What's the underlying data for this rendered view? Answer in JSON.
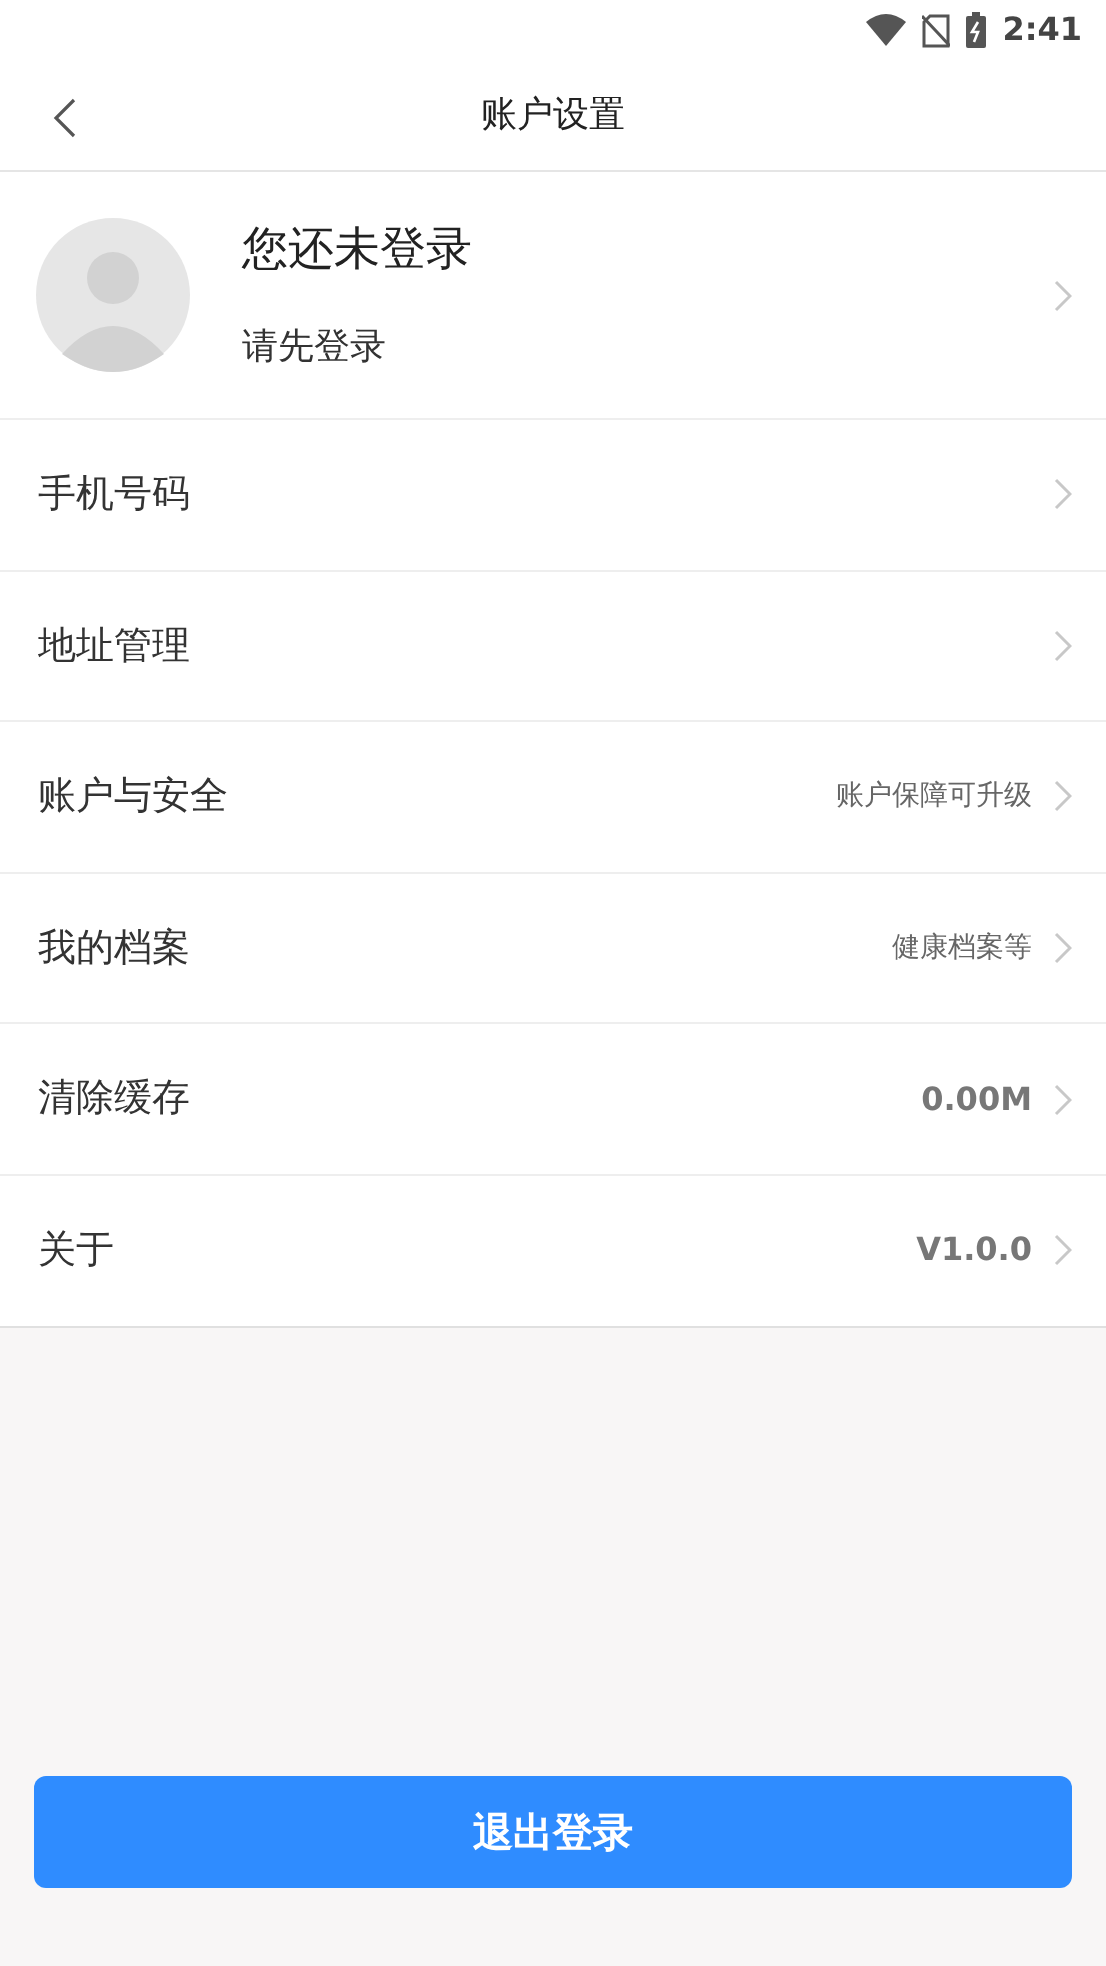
{
  "status_bar": {
    "time": "2:41"
  },
  "header": {
    "title": "账户设置"
  },
  "profile": {
    "name": "您还未登录",
    "hint": "请先登录"
  },
  "rows": [
    {
      "label": "手机号码"
    },
    {
      "label": "地址管理"
    },
    {
      "label": "账户与安全",
      "value": "账户保障可升级",
      "kind": "note"
    },
    {
      "label": "我的档案",
      "value": "健康档案等",
      "kind": "note"
    },
    {
      "label": "清除缓存",
      "value": "0.00M",
      "kind": "value"
    },
    {
      "label": "关于",
      "value": "V1.0.0",
      "kind": "value"
    }
  ],
  "logout_button": "退出登录"
}
